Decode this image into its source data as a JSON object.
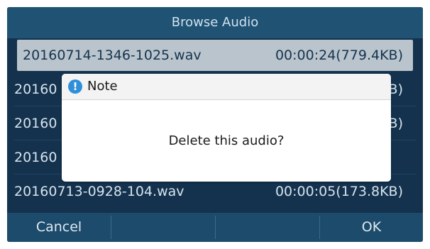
{
  "header": {
    "title": "Browse Audio"
  },
  "files": [
    {
      "name": "20160714-1346-1025.wav",
      "meta": "00:00:24(779.4KB)",
      "selected": true
    },
    {
      "name": "20160",
      "meta": "B)",
      "selected": false
    },
    {
      "name": "20160",
      "meta": "B)",
      "selected": false
    },
    {
      "name": "20160",
      "meta": "",
      "selected": false
    },
    {
      "name": "20160713-0928-104.wav",
      "meta": "00:00:05(173.8KB)",
      "selected": false
    }
  ],
  "dialog": {
    "title": "Note",
    "icon": "info-icon",
    "message": "Delete this audio?"
  },
  "softkeys": {
    "k1": "Cancel",
    "k2": "",
    "k3": "",
    "k4": "OK"
  },
  "colors": {
    "screen_bg": "#14324e",
    "title_bar": "#1f5273",
    "selected_row": "#b9c4cc",
    "info_icon": "#2f8fd9"
  }
}
